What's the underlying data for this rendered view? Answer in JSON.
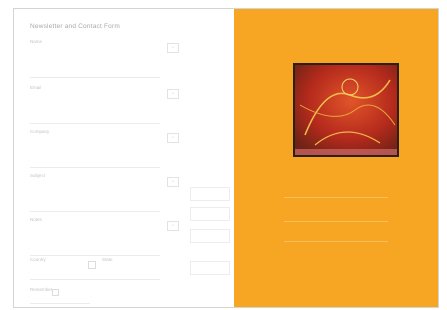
{
  "form": {
    "title": "Newsletter and Contact Form",
    "fields": [
      {
        "label": "Name",
        "value": "",
        "mark": "*"
      },
      {
        "label": "Email",
        "value": "",
        "mark": "*"
      },
      {
        "label": "Company",
        "value": "",
        "mark": "*"
      },
      {
        "label": "Subject",
        "value": "",
        "mark": "*"
      },
      {
        "label": "Notes",
        "value": "",
        "mark": "*"
      }
    ],
    "aux_buttons": [
      "",
      "",
      "",
      ""
    ],
    "pair": {
      "label_a": "Country",
      "label_b": "State"
    },
    "bottom_label": "Remember"
  },
  "promo": {
    "background_color": "#f6a623",
    "image_icon": "abstract-artwork",
    "title": "",
    "lines": [
      "",
      "",
      ""
    ]
  }
}
